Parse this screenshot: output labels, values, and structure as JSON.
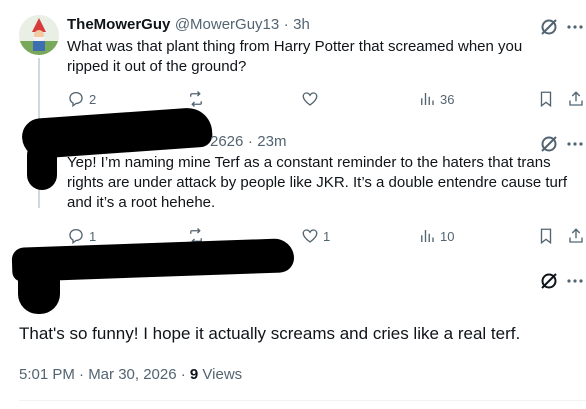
{
  "tweet1": {
    "display_name": "TheMowerGuy",
    "handle": "@MowerGuy13",
    "time": "3h",
    "text": "What was that plant thing from Harry Potter that screamed when you ripped it out of the ground?",
    "replies": "2",
    "retweets": "",
    "likes": "",
    "views": "36"
  },
  "tweet2": {
    "handle_fragment": "2626",
    "time": "23m",
    "text": "Yep! I’m naming mine Terf as a constant reminder to the haters that trans rights are under attack by people like JKR. It’s a double entendre cause turf and it’s a root hehehe.",
    "replies": "1",
    "retweets": "",
    "likes": "1",
    "views": "10"
  },
  "main_tweet": {
    "text": "That's so funny! I hope it actually screams and cries like a real terf.",
    "timestamp": "5:01 PM · Mar 30, 2026 · ",
    "views_count": "9",
    "views_label": " Views"
  },
  "icons": [
    "grok-icon",
    "more-icon",
    "reply-icon",
    "retweet-icon",
    "like-icon",
    "views-icon",
    "bookmark-icon",
    "share-icon"
  ],
  "colors": {
    "muted": "#536471",
    "text": "#0f1419",
    "line": "#cfd9de"
  }
}
